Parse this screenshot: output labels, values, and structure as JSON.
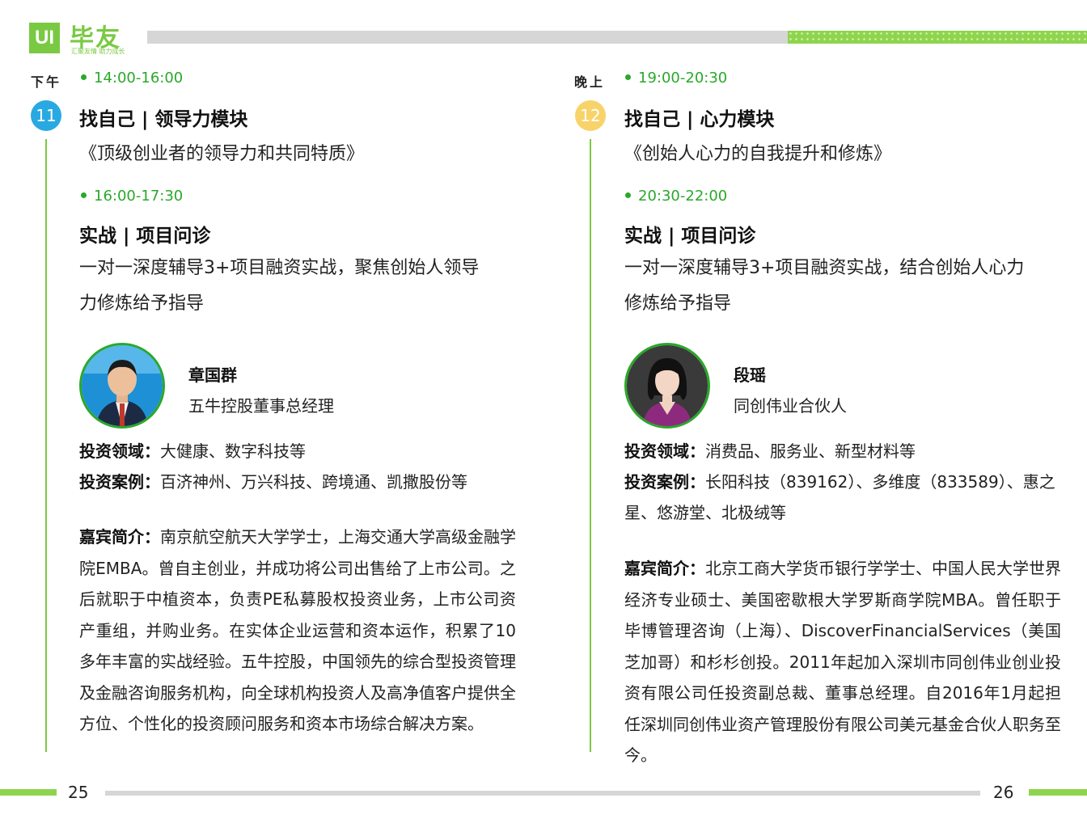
{
  "header": {
    "logo_mark": "UI",
    "logo_name": "毕友",
    "logo_slogan": "汇聚友情  助力成长",
    "accent_color": "#7ac943"
  },
  "left": {
    "period": "下午",
    "badge_number": "11",
    "badge_color": "#29a9e1",
    "session1": {
      "time": "14:00-16:00",
      "title": "找自己 | 领导力模块",
      "subtitle": "《顶级创业者的领导力和共同特质》"
    },
    "session2": {
      "time": "16:00-17:30",
      "title": "实战 | 项目问诊",
      "desc_line1": "一对一深度辅导3+项目融资实战，聚焦创始人领导",
      "desc_line2": "力修炼给予指导"
    },
    "speaker": {
      "name": "章国群",
      "role": "五牛控股董事总经理",
      "field_label": "投资领域：",
      "field_value": "大健康、数字科技等",
      "cases_label": "投资案例：",
      "cases_value": "百济神州、万兴科技、跨境通、凯撒股份等",
      "bio_label": "嘉宾简介：",
      "bio_value": "南京航空航天大学学士，上海交通大学高级金融学院EMBA。曾自主创业，并成功将公司出售给了上市公司。之后就职于中植资本，负责PE私募股权投资业务，上市公司资产重组，并购业务。在实体企业运营和资本运作，积累了10多年丰富的实战经验。五牛控股，中国领先的综合型投资管理及金融咨询服务机构，向全球机构投资人及高净值客户提供全方位、个性化的投资顾问服务和资本市场综合解决方案。"
    },
    "page_number": "25"
  },
  "right": {
    "period": "晚上",
    "badge_number": "12",
    "badge_color": "#f7d36a",
    "session1": {
      "time": "19:00-20:30",
      "title": "找自己 | 心力模块",
      "subtitle": "《创始人心力的自我提升和修炼》"
    },
    "session2": {
      "time": "20:30-22:00",
      "title": "实战 | 项目问诊",
      "desc_line1": "一对一深度辅导3+项目融资实战，结合创始人心力",
      "desc_line2": "修炼给予指导"
    },
    "speaker": {
      "name": "段瑶",
      "role": "同创伟业合伙人",
      "field_label": "投资领域：",
      "field_value": "消费品、服务业、新型材料等",
      "cases_label": "投资案例：",
      "cases_value": "长阳科技（839162）、多维度（833589）、惠之星、悠游堂、北极绒等",
      "bio_label": "嘉宾简介：",
      "bio_value": "北京工商大学货币银行学学士、中国人民大学世界经济专业硕士、美国密歇根大学罗斯商学院MBA。曾任职于毕博管理咨询（上海）、DiscoverFinancialServices（美国芝加哥）和杉杉创投。2011年起加入深圳市同创伟业创业投资有限公司任投资副总裁、董事总经理。自2016年1月起担任深圳同创伟业资产管理股份有限公司美元基金合伙人职务至今。"
    },
    "page_number": "26"
  }
}
